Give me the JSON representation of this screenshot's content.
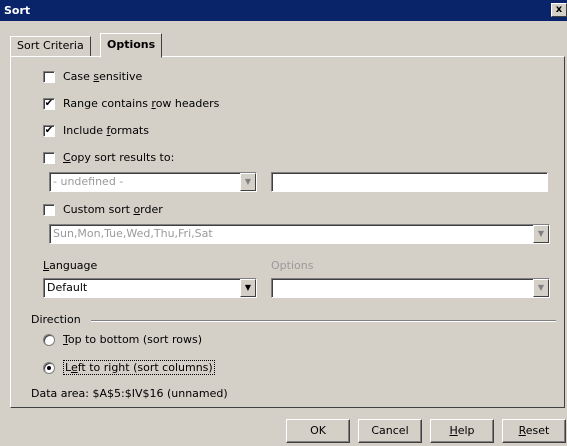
{
  "window": {
    "title": "Sort",
    "close_glyph": "x"
  },
  "tabs": [
    {
      "label": "Sort Criteria",
      "active": false
    },
    {
      "label": "Options",
      "active": true
    }
  ],
  "options": {
    "case_sensitive": {
      "pre": "Case ",
      "u": "s",
      "post": "ensitive",
      "checked": false
    },
    "row_headers": {
      "pre": "Range contains ",
      "u": "r",
      "post": "ow headers",
      "checked": true
    },
    "include_formats": {
      "pre": "Include ",
      "u": "f",
      "post": "ormats",
      "checked": true
    },
    "copy_results": {
      "pre": "",
      "u": "C",
      "post": "opy sort results to:",
      "checked": false
    },
    "copy_target_select": "- undefined -",
    "copy_target_input": "",
    "custom_order": {
      "pre": "Custom sort ",
      "u": "o",
      "post": "rder",
      "checked": false
    },
    "custom_order_select": "Sun,Mon,Tue,Wed,Thu,Fri,Sat",
    "language_label": {
      "u": "L",
      "post": "anguage"
    },
    "language_value": "Default",
    "options_label": "Options",
    "options_value": ""
  },
  "direction": {
    "label": "Direction",
    "top_to_bottom": {
      "u": "T",
      "post": "op to bottom (sort rows)",
      "selected": false
    },
    "left_to_right": {
      "pre": "L",
      "u": "e",
      "post": "ft to right (sort columns)",
      "selected": true
    }
  },
  "data_area": "Data area: $A$5:$IV$16 (unnamed)",
  "buttons": {
    "ok": "OK",
    "cancel": "Cancel",
    "help": {
      "u": "H",
      "post": "elp"
    },
    "reset": {
      "u": "R",
      "post": "eset"
    }
  },
  "icons": {
    "check": "✔",
    "dropdown": "▼"
  },
  "colors": {
    "titlebar": "#0a246a",
    "face": "#d4d0c8"
  }
}
